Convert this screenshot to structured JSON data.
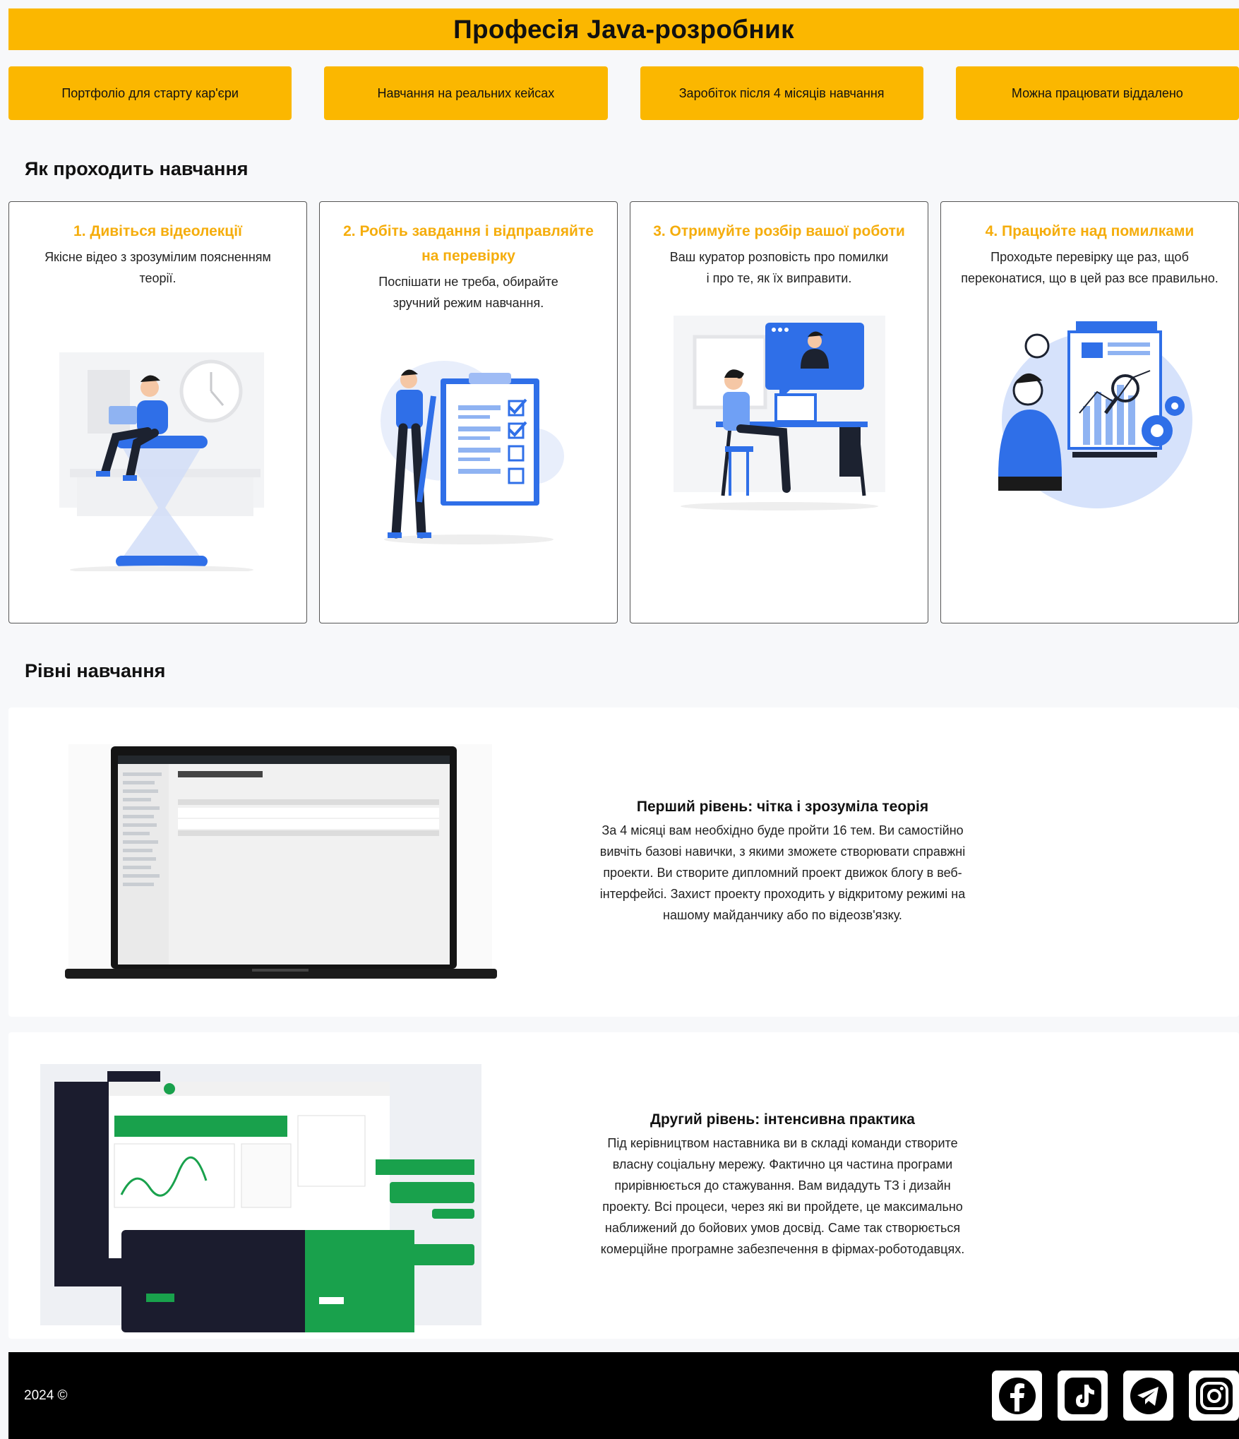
{
  "hero": {
    "title": "Професія Java-розробник"
  },
  "features": [
    "Портфоліо для старту кар'єри",
    "Навчання на реальних кейсах",
    "Заробіток після 4 місяців навчання",
    "Можна працювати віддалено"
  ],
  "how": {
    "title": "Як проходить навчання",
    "steps": [
      {
        "title": "1. Дивіться відеолекції",
        "text": "Якісне відео з зрозумілим поясненням теорії."
      },
      {
        "title": "2. Робіть завдання і відправляйте на перевірку",
        "text": "Поспішати не треба, обирайте зручний режим навчання."
      },
      {
        "title": "3. Отримуйте розбір вашої роботи",
        "text": "Ваш куратор розповість про помилки і про те, як їх виправити."
      },
      {
        "title": "4. Працюйте над помилками",
        "text": "Проходьте перевірку ще раз, щоб переконатися, що в цей раз все правильно."
      }
    ]
  },
  "levels": {
    "title": "Рівні навчання",
    "items": [
      {
        "title": "Перший рівень: чітка і зрозуміла теорія",
        "text": "За 4 місяці вам необхідно буде пройти 16 тем. Ви самостійно вивчіть базові навички, з якими зможете створювати справжні проекти. Ви створите дипломний проект движок блогу в веб-інтерфейсі. Захист проекту проходить у відкритому режимі на нашому майданчику або по відеозв'язку."
      },
      {
        "title": "Другий рівень: інтенсивна практика",
        "text": "Під керівництвом наставника ви в складі команди створите власну соціальну мережу. Фактично ця частина програми прирівнюється до стажування. Вам видадуть ТЗ і дизайн проекту. Всі процеси, через які ви пройдете, це максимально наближений до бойових умов досвід. Саме так створюється комерційне програмне забезпечення в фірмах-роботодавцях."
      }
    ]
  },
  "footer": {
    "copyright": "2024 ©",
    "socials": [
      "facebook-icon",
      "tiktok-icon",
      "telegram-icon",
      "instagram-icon"
    ]
  },
  "colors": {
    "accent": "#fbb700",
    "step_title": "#f5ad0c",
    "illustration_blue": "#2f6fe8",
    "footer_bg": "#000000"
  }
}
